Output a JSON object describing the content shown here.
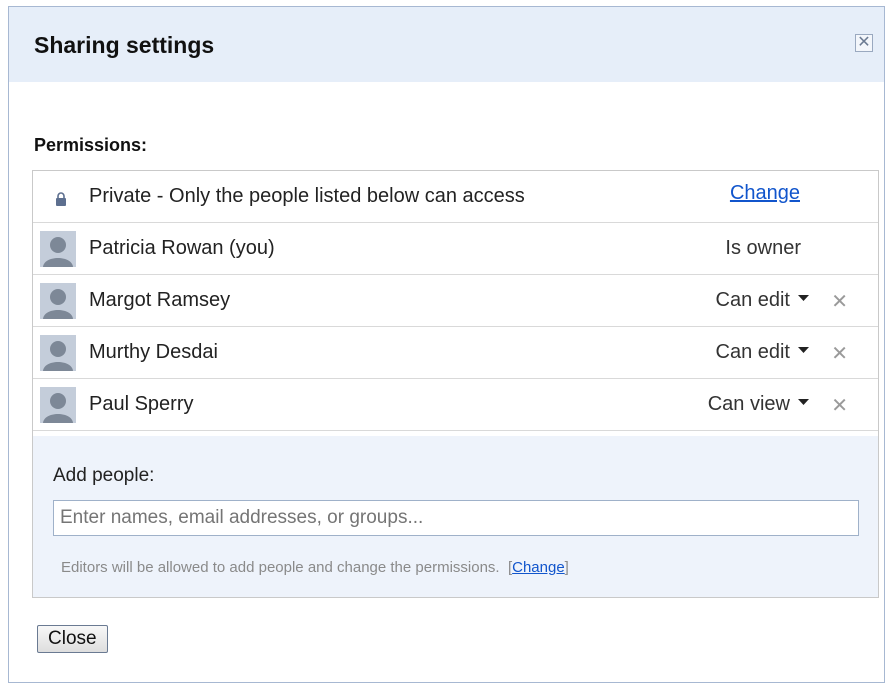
{
  "dialog": {
    "title": "Sharing settings",
    "close_icon": "close-icon"
  },
  "permissions": {
    "label": "Permissions:",
    "visibility": {
      "icon": "lock-icon",
      "text": "Private - Only the people listed below can access",
      "change_label": "Change"
    },
    "people": [
      {
        "name": "Patricia Rowan (you)",
        "role": "Is owner",
        "removable": false
      },
      {
        "name": "Margot Ramsey",
        "role": "Can edit",
        "removable": true
      },
      {
        "name": "Murthy Desdai",
        "role": "Can edit",
        "removable": true
      },
      {
        "name": "Paul Sperry",
        "role": "Can view",
        "removable": true
      }
    ],
    "remove_symbol": "✕"
  },
  "add_people": {
    "label": "Add people:",
    "placeholder": "Enter names, email addresses, or groups...",
    "hint_text": "Editors will be allowed to add people and change the permissions.",
    "hint_bracket_open": "[",
    "hint_link": "Change",
    "hint_bracket_close": "]"
  },
  "footer": {
    "close_label": "Close"
  },
  "colors": {
    "title_bar": "#e6eef9",
    "add_area": "#eef3fb",
    "link": "#1155cc"
  }
}
